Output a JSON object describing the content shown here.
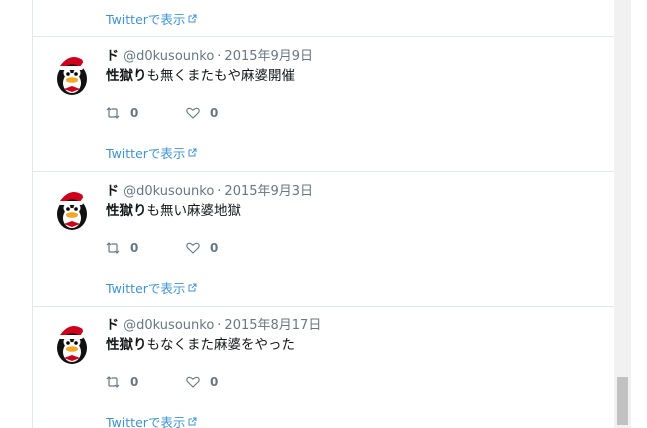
{
  "top": {
    "view_label": "Twitterで表示"
  },
  "tweets": [
    {
      "display_name": "ド",
      "handle": "@d0kusounko",
      "separator": "·",
      "date": "2015年9月9日",
      "text_bold": "性獄り",
      "text_rest": "も無くまたもや麻婆開催",
      "retweet_count": "0",
      "like_count": "0",
      "view_label": "Twitterで表示"
    },
    {
      "display_name": "ド",
      "handle": "@d0kusounko",
      "separator": "·",
      "date": "2015年9月3日",
      "text_bold": "性獄り",
      "text_rest": "も無い麻婆地獄",
      "retweet_count": "0",
      "like_count": "0",
      "view_label": "Twitterで表示"
    },
    {
      "display_name": "ド",
      "handle": "@d0kusounko",
      "separator": "·",
      "date": "2015年8月17日",
      "text_bold": "性獄り",
      "text_rest": "もなくまた麻婆をやった",
      "retweet_count": "0",
      "like_count": "0",
      "view_label": "Twitterで表示"
    }
  ],
  "colors": {
    "link": "#3b94d9",
    "text": "#14171a",
    "muted": "#657786",
    "border": "#e1e8ed"
  },
  "icons": {
    "retweet": "retweet-icon",
    "like": "heart-icon",
    "external": "external-link-icon",
    "avatar": "santa-penguin-avatar"
  }
}
